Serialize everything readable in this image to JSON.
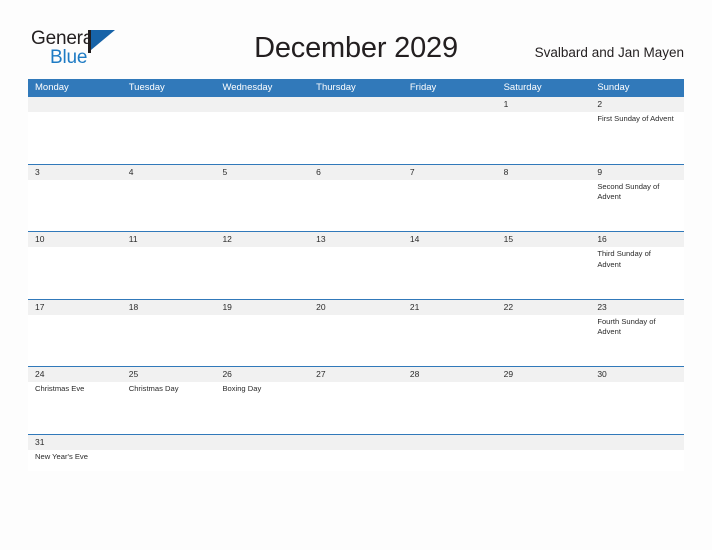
{
  "brand": {
    "word_one": "General",
    "word_two": "Blue",
    "accent_color": "#1e7bc4",
    "flag_color": "#1763a8"
  },
  "header": {
    "title": "December 2029",
    "region": "Svalbard and Jan Mayen"
  },
  "calendar": {
    "header_color": "#3179ba",
    "band_color": "#f1f1f1",
    "weekdays": [
      "Monday",
      "Tuesday",
      "Wednesday",
      "Thursday",
      "Friday",
      "Saturday",
      "Sunday"
    ],
    "weeks": [
      [
        {
          "day": "",
          "event": ""
        },
        {
          "day": "",
          "event": ""
        },
        {
          "day": "",
          "event": ""
        },
        {
          "day": "",
          "event": ""
        },
        {
          "day": "",
          "event": ""
        },
        {
          "day": "1",
          "event": ""
        },
        {
          "day": "2",
          "event": "First Sunday of Advent"
        }
      ],
      [
        {
          "day": "3",
          "event": ""
        },
        {
          "day": "4",
          "event": ""
        },
        {
          "day": "5",
          "event": ""
        },
        {
          "day": "6",
          "event": ""
        },
        {
          "day": "7",
          "event": ""
        },
        {
          "day": "8",
          "event": ""
        },
        {
          "day": "9",
          "event": "Second Sunday of Advent"
        }
      ],
      [
        {
          "day": "10",
          "event": ""
        },
        {
          "day": "11",
          "event": ""
        },
        {
          "day": "12",
          "event": ""
        },
        {
          "day": "13",
          "event": ""
        },
        {
          "day": "14",
          "event": ""
        },
        {
          "day": "15",
          "event": ""
        },
        {
          "day": "16",
          "event": "Third Sunday of Advent"
        }
      ],
      [
        {
          "day": "17",
          "event": ""
        },
        {
          "day": "18",
          "event": ""
        },
        {
          "day": "19",
          "event": ""
        },
        {
          "day": "20",
          "event": ""
        },
        {
          "day": "21",
          "event": ""
        },
        {
          "day": "22",
          "event": ""
        },
        {
          "day": "23",
          "event": "Fourth Sunday of Advent"
        }
      ],
      [
        {
          "day": "24",
          "event": "Christmas Eve"
        },
        {
          "day": "25",
          "event": "Christmas Day"
        },
        {
          "day": "26",
          "event": "Boxing Day"
        },
        {
          "day": "27",
          "event": ""
        },
        {
          "day": "28",
          "event": ""
        },
        {
          "day": "29",
          "event": ""
        },
        {
          "day": "30",
          "event": ""
        }
      ],
      [
        {
          "day": "31",
          "event": "New Year's Eve"
        },
        {
          "day": "",
          "event": ""
        },
        {
          "day": "",
          "event": ""
        },
        {
          "day": "",
          "event": ""
        },
        {
          "day": "",
          "event": ""
        },
        {
          "day": "",
          "event": ""
        },
        {
          "day": "",
          "event": ""
        }
      ]
    ]
  }
}
